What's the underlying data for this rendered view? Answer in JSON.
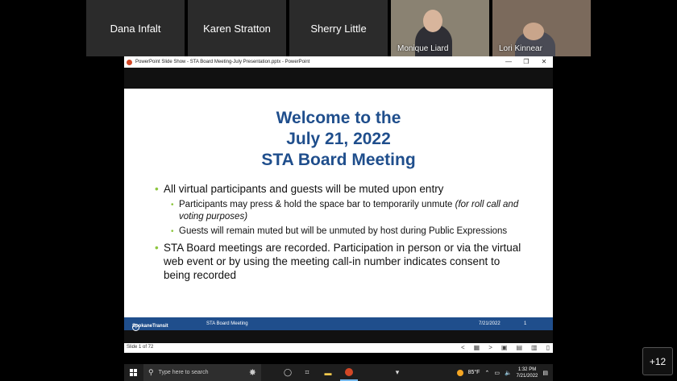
{
  "participants": [
    {
      "name": "Dana Infalt"
    },
    {
      "name": "Karen Stratton"
    },
    {
      "name": "Sherry Little"
    },
    {
      "name": "Monique Liard"
    },
    {
      "name": "Lori Kinnear"
    }
  ],
  "overflow_count": "+12",
  "window": {
    "title": "PowerPoint Slide Show  -  STA Board Meeting-July Presentation.pptx  -  PowerPoint",
    "minimize": "—",
    "restore": "❐",
    "close": "✕"
  },
  "slide": {
    "title_lines": [
      "Welcome to the",
      "July 21, 2022",
      "STA Board Meeting"
    ],
    "bullet1": "All virtual participants and guests will be muted upon entry",
    "sub1_text": "Participants may press & hold the space bar to temporarily unmute ",
    "sub1_italic": "(for roll call and voting purposes)",
    "sub2": "Guests will remain muted but will be unmuted by host during Public Expressions",
    "bullet2": "STA Board meetings are recorded. Participation in person or via the virtual web event or by using the meeting call-in number indicates consent to being recorded",
    "footer_logo": "SpokaneTransit",
    "footer_center": "STA Board Meeting",
    "footer_date": "7/21/2022",
    "footer_page": "1"
  },
  "status": {
    "slide_indicator": "Slide 1 of 72",
    "controls": [
      "<",
      "▦",
      ">",
      "▣",
      "▤",
      "▥",
      "▯"
    ]
  },
  "taskbar": {
    "search_placeholder": "Type here to search",
    "weather": "85°F",
    "time": "1:32 PM",
    "date": "7/21/2022"
  },
  "colors": {
    "slide_title": "#1f4e8c",
    "bullet": "#8dc63f",
    "footer_bar": "#1f4e8c"
  }
}
